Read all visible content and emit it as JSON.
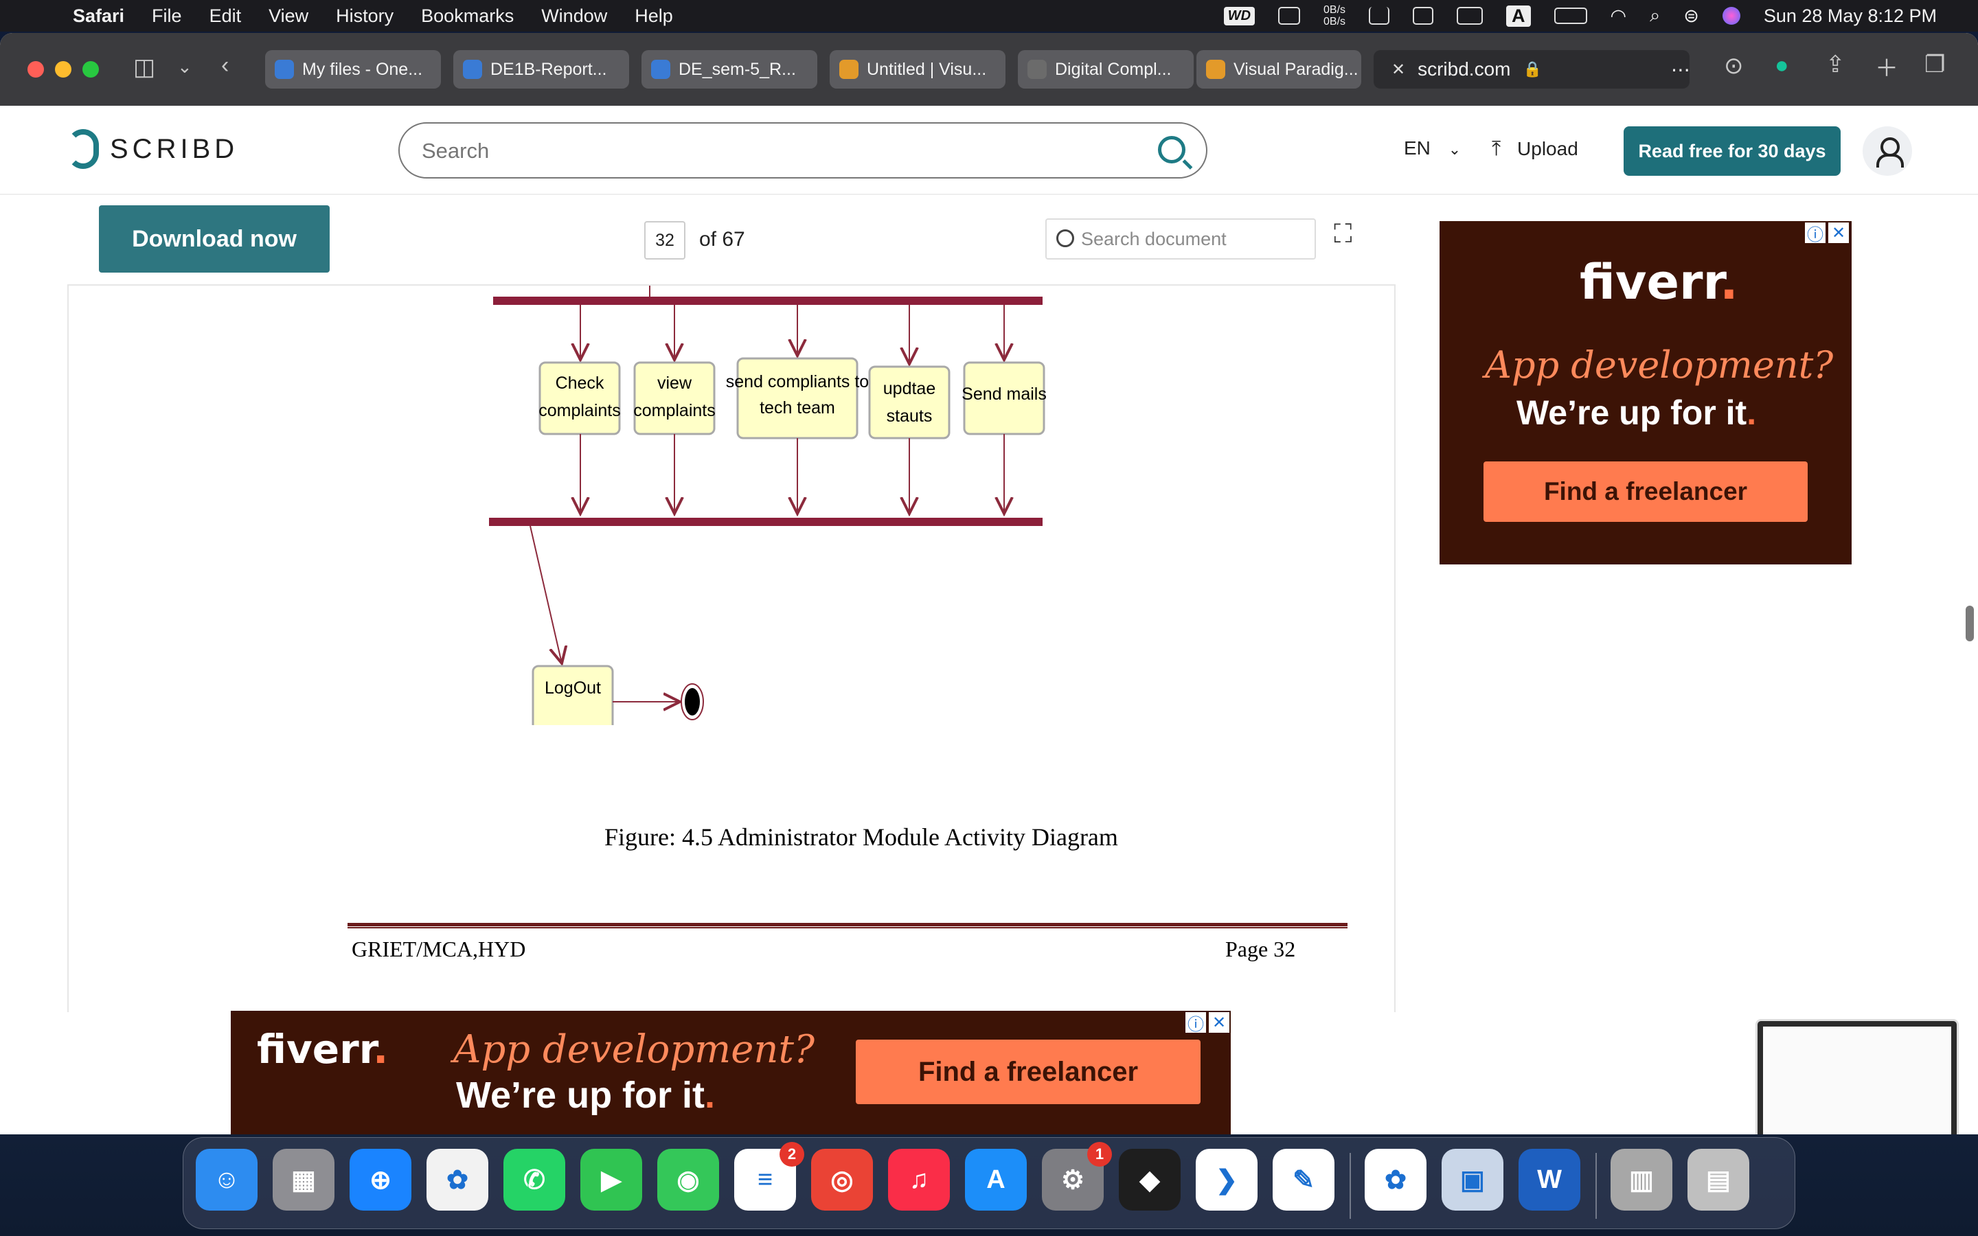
{
  "menubar": {
    "app": "Safari",
    "items": [
      "File",
      "Edit",
      "View",
      "History",
      "Bookmarks",
      "Window",
      "Help"
    ],
    "net_up": "0B/s",
    "net_down": "0B/s",
    "wd_label": "WD",
    "input_label": "A",
    "datetime": "Sun 28 May  8:12 PM"
  },
  "tabs": [
    {
      "label": "My files - One...",
      "favicon_color": "#3a7bd5"
    },
    {
      "label": "DE1B-Report...",
      "favicon_color": "#3a7bd5"
    },
    {
      "label": "DE_sem-5_R...",
      "favicon_color": "#3a7bd5"
    },
    {
      "label": "Untitled | Visu...",
      "favicon_color": "#e39a2a"
    },
    {
      "label": "Digital Compl...",
      "favicon_color": "#6b6b6b"
    },
    {
      "label": "Visual Paradig...",
      "favicon_color": "#e39a2a"
    }
  ],
  "address": {
    "domain": "scribd.com"
  },
  "scribd": {
    "logo_text": "SCRIBD",
    "search_placeholder": "Search",
    "lang": "EN",
    "upload": "Upload",
    "read_free": "Read free for 30 days"
  },
  "doc": {
    "download": "Download now",
    "page_number": "32",
    "page_total": "of 67",
    "search_placeholder": "Search document",
    "diagram": {
      "activities": [
        "Check complaints",
        "view complaints",
        "send compliants to tech team",
        "updtae stauts",
        "Send mails"
      ],
      "logout": "LogOut"
    },
    "caption": "Figure: 4.5 Administrator Module Activity Diagram",
    "footer_left": "GRIET/MCA,HYD",
    "footer_right": "Page 32"
  },
  "ad_side": {
    "brand": "fiverr",
    "headline": "App development?",
    "sub": "We’re up for it",
    "cta": "Find a freelancer"
  },
  "ad_bottom": {
    "brand": "fiverr",
    "headline": "App development?",
    "sub": "We’re up for it",
    "cta": "Find a freelancer"
  },
  "dock": {
    "apps": [
      {
        "name": "Finder",
        "glyph": "☺",
        "color": "#2d8cf0"
      },
      {
        "name": "Launchpad",
        "glyph": "▦",
        "color": "#8e8e93"
      },
      {
        "name": "Safari",
        "glyph": "⊕",
        "color": "#1a84ff"
      },
      {
        "name": "Photos",
        "glyph": "✿",
        "color": "#f2f2f2"
      },
      {
        "name": "WhatsApp",
        "glyph": "✆",
        "color": "#25d366"
      },
      {
        "name": "FaceTime",
        "glyph": "▶",
        "color": "#30c452"
      },
      {
        "name": "Find My",
        "glyph": "◉",
        "color": "#34c759"
      },
      {
        "name": "Reminders",
        "glyph": "≡",
        "color": "#ffffff",
        "badge": "2"
      },
      {
        "name": "Chrome",
        "glyph": "◎",
        "color": "#ea4335"
      },
      {
        "name": "Music",
        "glyph": "♫",
        "color": "#fa2d48"
      },
      {
        "name": "App Store",
        "glyph": "A",
        "color": "#1c8ef9"
      },
      {
        "name": "System Settings",
        "glyph": "⚙",
        "color": "#7d7d82",
        "badge": "1"
      },
      {
        "name": "Figma",
        "glyph": "◆",
        "color": "#1e1e1e"
      },
      {
        "name": "VS Code",
        "glyph": "❯",
        "color": "#ffffff"
      },
      {
        "name": "Xcode Tools",
        "glyph": "✎",
        "color": "#ffffff"
      },
      {
        "name": "Photos HD",
        "glyph": "✿",
        "color": "#ffffff"
      },
      {
        "name": "Preview",
        "glyph": "▣",
        "color": "#c9d6e8"
      },
      {
        "name": "Word",
        "glyph": "W",
        "color": "#1e5fbf"
      },
      {
        "name": "Archive",
        "glyph": "▥",
        "color": "#a7a7a7"
      },
      {
        "name": "Trash",
        "glyph": "▤",
        "color": "#bfbfbf"
      }
    ]
  }
}
